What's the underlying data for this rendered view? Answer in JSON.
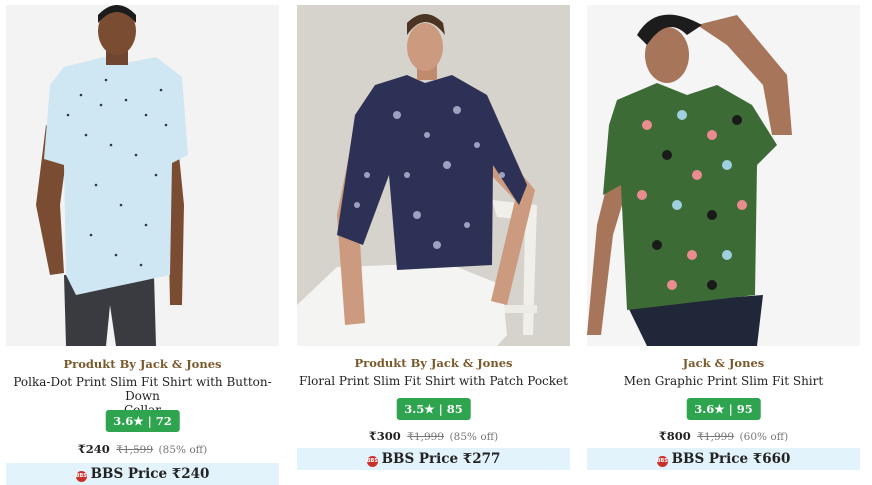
{
  "products": [
    {
      "brand": "Produkt By Jack & Jones",
      "title_line1": "Polka-Dot Print Slim Fit Shirt with Button-Down",
      "title_line2": "Collar",
      "rating": "3.6",
      "star": "★",
      "sep": "|",
      "reviews": "72",
      "price": "₹240",
      "mrp": "₹1,599",
      "discount": "(85% off)",
      "bbs_logo": "BBS",
      "bbs_price": "BBS Price ₹240",
      "image_icon": "model-shirt-image"
    },
    {
      "brand": "Produkt By Jack & Jones",
      "title_line1": "Floral Print Slim Fit Shirt with Patch Pocket",
      "title_line2": "",
      "rating": "3.5",
      "star": "★",
      "sep": "|",
      "reviews": "85",
      "price": "₹300",
      "mrp": "₹1,999",
      "discount": "(85% off)",
      "bbs_logo": "BBS",
      "bbs_price": "BBS Price ₹277",
      "image_icon": "model-shirt-image"
    },
    {
      "brand": "Jack & Jones",
      "title_line1": "Men Graphic Print Slim Fit Shirt",
      "title_line2": "",
      "rating": "3.6",
      "star": "★",
      "sep": "|",
      "reviews": "95",
      "price": "₹800",
      "mrp": "₹1,999",
      "discount": "(60% off)",
      "bbs_logo": "BBS",
      "bbs_price": "BBS Price ₹660",
      "image_icon": "model-shirt-image"
    }
  ],
  "colors": {
    "brand": "#7a5a2c",
    "rating_bg": "#2ea44f",
    "bbs_bg": "#e2f3fc",
    "bbs_logo": "#c9302c"
  }
}
